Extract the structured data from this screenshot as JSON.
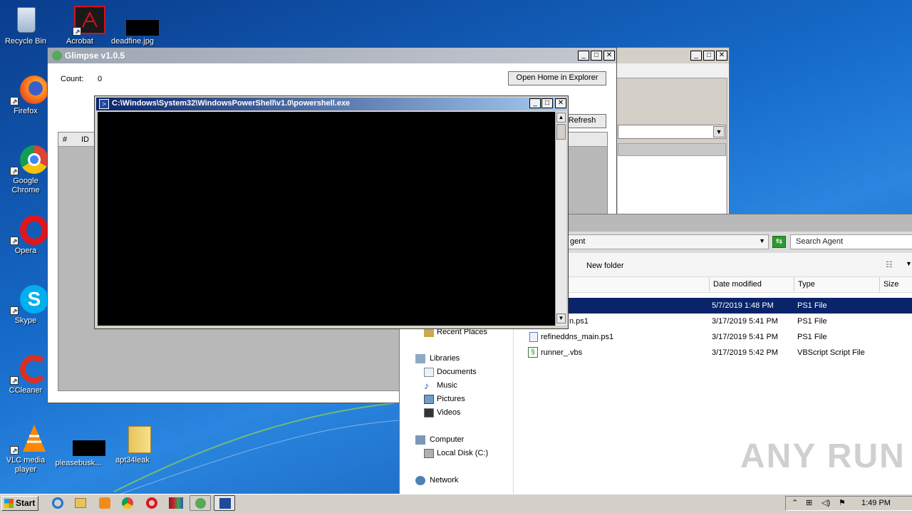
{
  "desktop": {
    "icons": [
      {
        "id": "recycle",
        "label": "Recycle Bin",
        "icon": "recycle-bin-icon"
      },
      {
        "id": "acrobat",
        "label": "Acrobat",
        "icon": "acrobat-icon"
      },
      {
        "id": "deadfine",
        "label": "deadfine.jpg",
        "icon": "image-file-icon"
      },
      {
        "id": "firefox",
        "label": "Firefox",
        "icon": "firefox-icon"
      },
      {
        "id": "chrome",
        "label": "Google Chrome",
        "icon": "chrome-icon"
      },
      {
        "id": "opera",
        "label": "Opera",
        "icon": "opera-icon"
      },
      {
        "id": "skype",
        "label": "Skype",
        "icon": "skype-icon"
      },
      {
        "id": "ccleaner",
        "label": "CCleaner",
        "icon": "ccleaner-icon"
      },
      {
        "id": "vlc",
        "label": "VLC media player",
        "icon": "vlc-icon"
      },
      {
        "id": "pleasebusk",
        "label": "pleasebusk...",
        "icon": "file-icon"
      },
      {
        "id": "apt34leak",
        "label": "apt34leak",
        "icon": "folder-icon"
      }
    ]
  },
  "glimpse": {
    "title": "Glimpse v1.0.5",
    "count_label": "Count:",
    "count_value": "0",
    "open_home_label": "Open Home in Explorer",
    "refresh_label": "Refresh",
    "columns": [
      "#",
      "ID"
    ]
  },
  "powershell": {
    "title": "C:\\Windows\\System32\\WindowsPowerShell\\v1.0\\powershell.exe"
  },
  "explorer": {
    "address_tail": "gent",
    "search_placeholder": "Search Agent",
    "new_folder_label": "New folder",
    "columns": {
      "date": "Date modified",
      "type": "Type",
      "size": "Size"
    },
    "files": [
      {
        "name": "",
        "date": "5/7/2019 1:48 PM",
        "type": "PS1 File",
        "selected": true
      },
      {
        "name": "n.ps1",
        "date": "3/17/2019 5:41 PM",
        "type": "PS1 File",
        "selected": false
      },
      {
        "name": "refineddns_main.ps1",
        "date": "3/17/2019 5:41 PM",
        "type": "PS1 File",
        "selected": false
      },
      {
        "name": "runner_.vbs",
        "date": "3/17/2019 5:42 PM",
        "type": "VBScript Script File",
        "selected": false
      }
    ],
    "nav": {
      "recent_places": "Recent Places",
      "libraries": "Libraries",
      "documents": "Documents",
      "music": "Music",
      "pictures": "Pictures",
      "videos": "Videos",
      "computer": "Computer",
      "local_disk": "Local Disk (C:)",
      "network": "Network"
    }
  },
  "taskbar": {
    "start_label": "Start",
    "clock": "1:49 PM"
  },
  "watermark": "ANY RUN",
  "colors": {
    "selection": "#0a246a",
    "titlebar_active": "#0a246a",
    "titlebar_inactive": "#808080",
    "accent": "#3399ff"
  }
}
